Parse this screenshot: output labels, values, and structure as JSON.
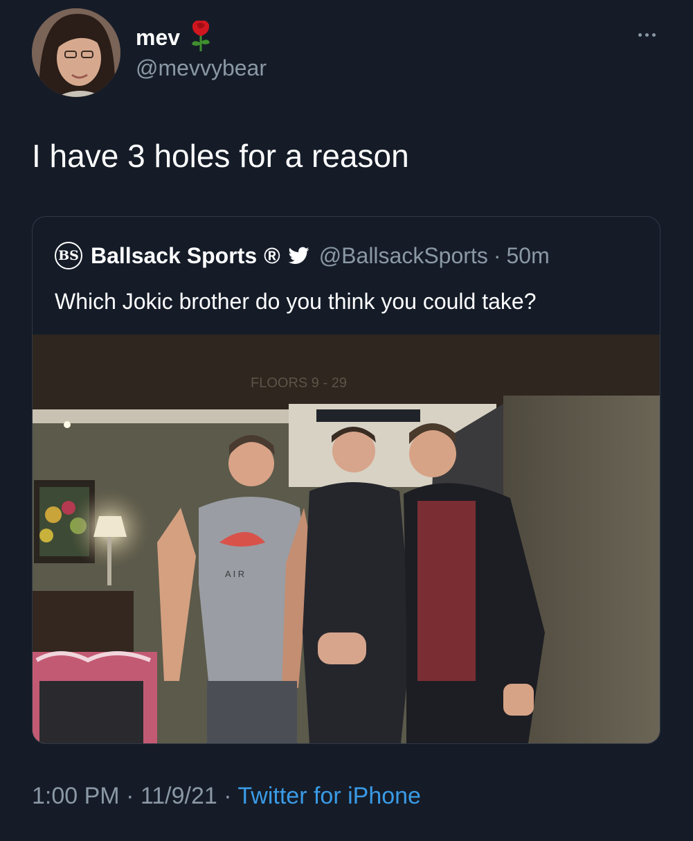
{
  "author": {
    "display_name": "mev",
    "handle": "@mevvybear",
    "name_emoji_icon": "rose-icon"
  },
  "tweet": {
    "text": "I have 3 holes for a reason"
  },
  "quoted_tweet": {
    "logo_text": "BS",
    "display_name": "Ballsack Sports",
    "registered_mark": "®",
    "bird_icon": "twitter-bird-icon",
    "handle": "@BallsackSports",
    "separator": "·",
    "time": "50m",
    "text": "Which Jokic brother do you think you could take?",
    "photo_sign_text": "FLOORS 9 - 29",
    "photo_shirt_text": "A I R"
  },
  "footer": {
    "time": "1:00 PM",
    "sep1": "·",
    "date": "11/9/21",
    "sep2": "·",
    "source": "Twitter for iPhone"
  },
  "colors": {
    "background": "#151c28",
    "secondary_text": "#8b98a5",
    "link": "#3a9be6"
  }
}
